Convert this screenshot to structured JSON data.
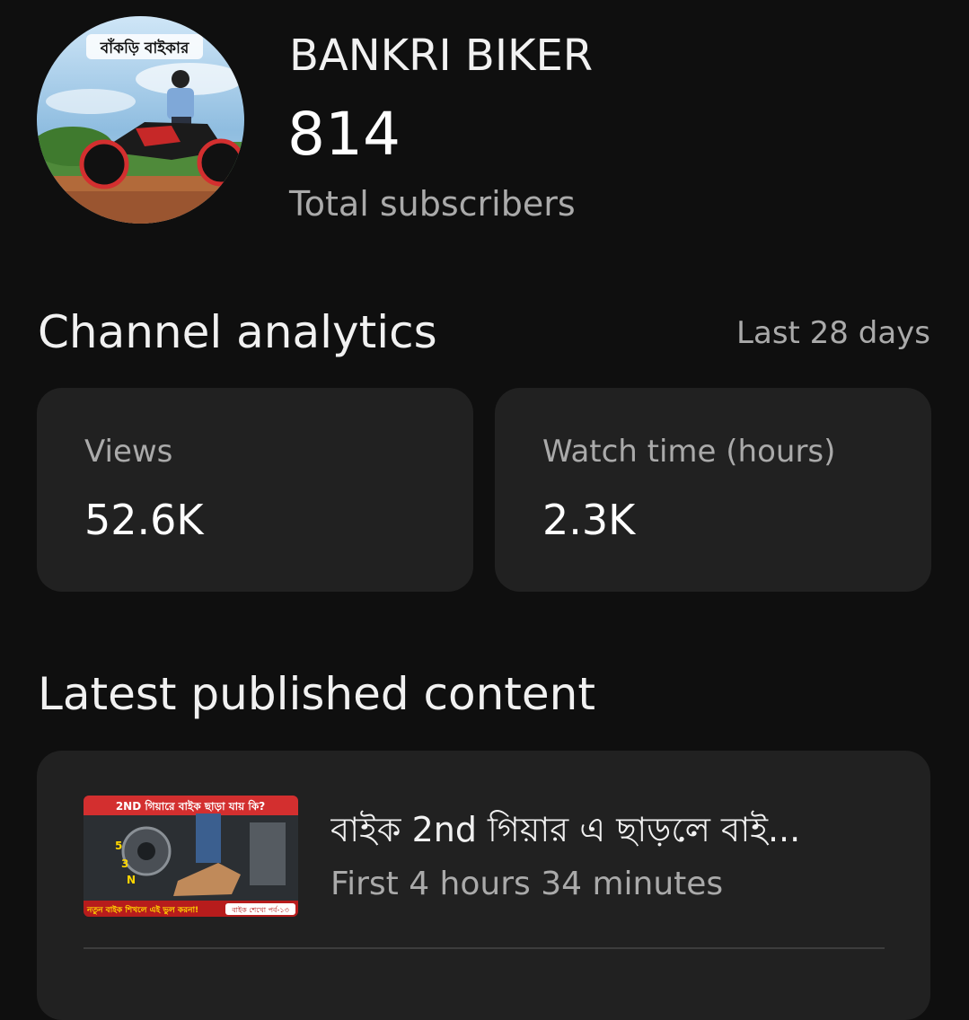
{
  "channel": {
    "name": "BANKRI BIKER",
    "subscriber_count": "814",
    "subscriber_label": "Total subscribers",
    "avatar_text": "বাঁকড়ি বাইকার"
  },
  "analytics": {
    "title": "Channel analytics",
    "period": "Last 28 days",
    "cards": [
      {
        "label": "Views",
        "value": "52.6K"
      },
      {
        "label": "Watch time (hours)",
        "value": "2.3K"
      }
    ]
  },
  "latest": {
    "title": "Latest published content",
    "video": {
      "title": "বাইক 2nd গিয়ার এ ছাড়লে বাই...",
      "stat": "First 4 hours 34 minutes",
      "thumbnail_top_text": "2ND গিয়ারে বাইক ছাড়া যায় কি?",
      "thumbnail_bottom_text": "নতুন বাইক শিখলে এই ভুল করনা!",
      "thumbnail_badge": "বাইক শেখো পর্ব-১৩"
    }
  },
  "colors": {
    "background": "#0f0f0f",
    "card": "#212121",
    "primary_text": "#f1f1f1",
    "secondary_text": "#aaaaaa",
    "thumb_banner": "#d32f2f",
    "thumb_bottom": "#ffd600"
  }
}
